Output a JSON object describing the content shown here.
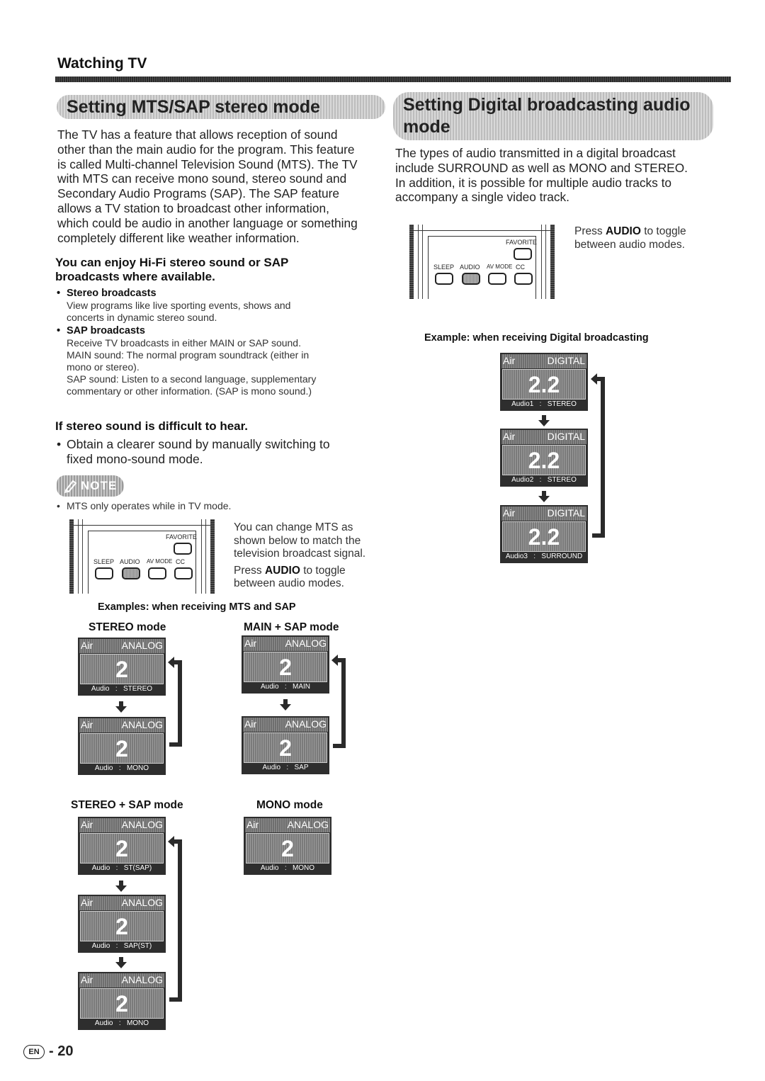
{
  "header": {
    "section_title": "Watching TV"
  },
  "left": {
    "heading": "Setting MTS/SAP stereo mode",
    "intro": [
      "The TV has a feature that allows reception of sound",
      "other than the main audio for the program. This feature",
      "is called Multi-channel Television Sound (MTS). The TV",
      "with MTS can receive mono sound, stereo sound and",
      "Secondary Audio Programs (SAP). The SAP feature",
      "allows a TV station to broadcast other information,",
      "which could be audio in another language or something",
      "completely different like weather information."
    ],
    "subheading_1": [
      "You can enjoy Hi-Fi stereo sound or SAP",
      "broadcasts where available."
    ],
    "bullets": [
      {
        "title": "Stereo broadcasts",
        "lines": [
          "View programs like live sporting events, shows and",
          "concerts in dynamic stereo sound."
        ]
      },
      {
        "title": "SAP broadcasts",
        "lines": [
          "Receive TV broadcasts in either MAIN or SAP sound.",
          "MAIN sound: The normal program soundtrack (either in",
          "mono or stereo).",
          "SAP sound: Listen to a second language, supplementary",
          "commentary or other information. (SAP is mono sound.)"
        ]
      }
    ],
    "subheading_2": "If stereo sound is difficult to hear.",
    "tip": [
      "Obtain a clearer sound by manually switching to",
      "fixed mono-sound mode."
    ],
    "note_label": "NOTE",
    "note_items": [
      "MTS only operates while in TV mode."
    ],
    "remote_caption": [
      "You can change MTS as",
      "shown below to match the",
      "television broadcast signal."
    ],
    "press_prefix": "Press ",
    "press_key": "AUDIO",
    "press_suffix_1": " to toggle",
    "press_suffix_2": "between audio modes.",
    "examples_title": "Examples: when receiving MTS and SAP",
    "modes": [
      {
        "label": "STEREO mode",
        "screens": [
          {
            "src": "Air",
            "type": "ANALOG",
            "channel": "2",
            "audio": "Audio   :   STEREO"
          },
          {
            "src": "Air",
            "type": "ANALOG",
            "channel": "2",
            "audio": "Audio   :   MONO"
          }
        ]
      },
      {
        "label": "MAIN + SAP mode",
        "screens": [
          {
            "src": "Air",
            "type": "ANALOG",
            "channel": "2",
            "audio": "Audio   :   MAIN"
          },
          {
            "src": "Air",
            "type": "ANALOG",
            "channel": "2",
            "audio": "Audio   :   SAP"
          }
        ]
      },
      {
        "label": "STEREO + SAP mode",
        "screens": [
          {
            "src": "Air",
            "type": "ANALOG",
            "channel": "2",
            "audio": "Audio   :   ST(SAP)"
          },
          {
            "src": "Air",
            "type": "ANALOG",
            "channel": "2",
            "audio": "Audio   :   SAP(ST)"
          },
          {
            "src": "Air",
            "type": "ANALOG",
            "channel": "2",
            "audio": "Audio   :   MONO"
          }
        ]
      },
      {
        "label": "MONO mode",
        "screens": [
          {
            "src": "Air",
            "type": "ANALOG",
            "channel": "2",
            "audio": "Audio   :   MONO"
          }
        ]
      }
    ]
  },
  "right": {
    "heading": [
      "Setting Digital broadcasting audio",
      "mode"
    ],
    "intro": [
      "The types of audio transmitted in a digital broadcast",
      "include SURROUND as well as MONO and STEREO.",
      "In addition, it is possible for multiple audio tracks to",
      "accompany a single video track."
    ],
    "press_prefix": "Press ",
    "press_key": "AUDIO",
    "press_suffix_1": " to toggle",
    "press_suffix_2": "between audio modes.",
    "example_title": "Example: when receiving Digital broadcasting",
    "screens": [
      {
        "src": "Air",
        "type": "DIGITAL",
        "channel": "2.2",
        "audio": "Audio1   :   STEREO"
      },
      {
        "src": "Air",
        "type": "DIGITAL",
        "channel": "2.2",
        "audio": "Audio2   :   STEREO"
      },
      {
        "src": "Air",
        "type": "DIGITAL",
        "channel": "2.2",
        "audio": "Audio3   :   SURROUND"
      }
    ]
  },
  "remote": {
    "favorite": "FAVORITE",
    "sleep": "SLEEP",
    "audio": "AUDIO",
    "avmode": "AV MODE",
    "cc": "CC"
  },
  "footer": {
    "lang_badge": "EN",
    "separator": "-",
    "page_number": "20"
  }
}
